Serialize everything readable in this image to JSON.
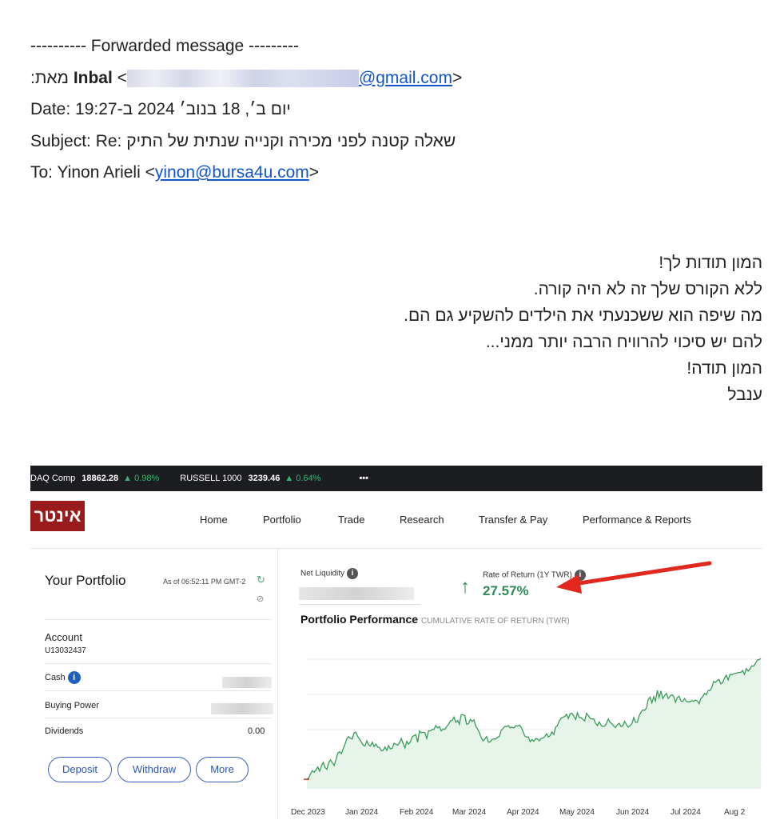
{
  "email": {
    "separator": "---------- Forwarded message ---------",
    "from_label": ":מאת",
    "from_name": "Inbal",
    "from_email_domain": "@gmail.com",
    "from_close": ">",
    "from_open": "<",
    "date_line": "Date: יום ב׳, 18 בנוב׳ 2024 ב-19:27",
    "subject_line": "Subject: Re: שאלה קטנה לפני מכירה וקנייה שנתית של התיק",
    "to_prefix": "To: Yinon Arieli <",
    "to_email": "yinon@bursa4u.com",
    "to_suffix": ">"
  },
  "message_lines": [
    "המון תודות לך!",
    "ללא הקורס שלך זה לא היה קורה.",
    "מה שיפה הוא ששכנעתי את הילדים להשקיע גם הם.",
    "להם יש סיכוי להרוויח הרבה יותר ממני...",
    "המון תודה!",
    "ענבל"
  ],
  "ticker": {
    "item1_name": "DAQ Comp",
    "item1_value": "18862.28",
    "item1_change": "▲ 0.98%",
    "item2_name": "RUSSELL 1000",
    "item2_value": "3239.46",
    "item2_change": "▲ 0.64%",
    "more": "•••"
  },
  "brand": "אינטר",
  "nav": [
    "Home",
    "Portfolio",
    "Trade",
    "Research",
    "Transfer & Pay",
    "Performance & Reports"
  ],
  "portfolio": {
    "title": "Your Portfolio",
    "as_of": "As of 06:52:11 PM GMT-2",
    "account_label": "Account",
    "account_id": "U13032437",
    "cash_label": "Cash",
    "buying_power_label": "Buying Power",
    "dividends_label": "Dividends",
    "dividends_value": "0.00",
    "buttons": [
      "Deposit",
      "Withdraw",
      "More"
    ]
  },
  "summary": {
    "net_liquidity_label": "Net Liquidity",
    "ror_label": "Rate of Return (1Y TWR)",
    "ror_value": "27.57%",
    "perf_title": "Portfolio Performance",
    "perf_subtitle": "CUMULATIVE RATE OF RETURN (TWR)"
  },
  "colors": {
    "accent_green": "#2e8b57",
    "arrow_red": "#e0281e",
    "link_blue": "#1155cc"
  },
  "chart_data": {
    "type": "area",
    "title": "Portfolio Performance",
    "subtitle": "CUMULATIVE RATE OF RETURN (TWR)",
    "x_tick_labels": [
      "Dec 2023",
      "Jan 2024",
      "Feb 2024",
      "Mar 2024",
      "Apr 2024",
      "May 2024",
      "Jun 2024",
      "Jul 2024",
      "Aug 2"
    ],
    "x": [
      0,
      1,
      2,
      3,
      4,
      5,
      6,
      7,
      8,
      9,
      10,
      11,
      12,
      13,
      14,
      15,
      16,
      17,
      18,
      19,
      20,
      21,
      22,
      23,
      24,
      25,
      26,
      27,
      28,
      29,
      30,
      31,
      32,
      33,
      34,
      35,
      36,
      37,
      38,
      39,
      40,
      41,
      42,
      43,
      44,
      45,
      46,
      47,
      48,
      49,
      50,
      51,
      52,
      53,
      54,
      55,
      56,
      57,
      58,
      59,
      60,
      61,
      62,
      63,
      64,
      65,
      66,
      67,
      68,
      69,
      70,
      71,
      72,
      73,
      74,
      75,
      76,
      77,
      78,
      79,
      80,
      81,
      82,
      83,
      84,
      85,
      86,
      87,
      88,
      89,
      90,
      91,
      92,
      93,
      94,
      95,
      96,
      97,
      98,
      99,
      100,
      101,
      102,
      103,
      104,
      105,
      106,
      107,
      108,
      109,
      110,
      111,
      112,
      113,
      114,
      115,
      116,
      117,
      118,
      119,
      120,
      121,
      122,
      123,
      124,
      125,
      126,
      127,
      128,
      129,
      130,
      131,
      132,
      133,
      134,
      135,
      136,
      137,
      138,
      139,
      140,
      141,
      142,
      143,
      144,
      145,
      146,
      147,
      148,
      149,
      150,
      151,
      152,
      153,
      154,
      155,
      156,
      157,
      158,
      159,
      160,
      161,
      162,
      163,
      164,
      165,
      166,
      167,
      168,
      169,
      170,
      171,
      172,
      173,
      174,
      175,
      176,
      177,
      178,
      179,
      180,
      181,
      182,
      183,
      184,
      185,
      186,
      187,
      188,
      189,
      190,
      191,
      192,
      193,
      194,
      195,
      196,
      197,
      198,
      199,
      200,
      201,
      202,
      203,
      204,
      205,
      206,
      207,
      208,
      209,
      210,
      211,
      212,
      213,
      214,
      215,
      216,
      217,
      218,
      219,
      220,
      221,
      222,
      223,
      224,
      225,
      226,
      227,
      228,
      229,
      230,
      231,
      232,
      233,
      234,
      235,
      236,
      237,
      238,
      239,
      240,
      241,
      242,
      243,
      244,
      245,
      246,
      247,
      248,
      249,
      250
    ],
    "y": [
      0.0,
      0.3,
      1.1,
      1.8,
      1.5,
      2.0,
      2.6,
      1.7,
      2.8,
      3.6,
      2.5,
      2.1,
      3.5,
      4.1,
      3.5,
      2.9,
      4.1,
      5.5,
      5.8,
      5.4,
      6.4,
      7.4,
      8.6,
      9.0,
      8.6,
      8.5,
      9.8,
      9.9,
      9.0,
      8.5,
      7.8,
      7.2,
      7.0,
      8.1,
      7.3,
      7.0,
      7.8,
      6.9,
      7.4,
      6.8,
      6.7,
      6.0,
      6.1,
      6.8,
      6.1,
      7.1,
      6.4,
      6.5,
      7.6,
      7.4,
      7.2,
      7.7,
      8.6,
      7.6,
      6.6,
      8.0,
      7.4,
      7.9,
      8.9,
      9.2,
      9.4,
      7.8,
      10.2,
      9.8,
      9.9,
      9.8,
      8.6,
      10.2,
      10.2,
      10.5,
      10.5,
      11.3,
      10.8,
      11.1,
      10.2,
      10.6,
      10.5,
      11.1,
      11.6,
      12.3,
      12.4,
      13.1,
      12.0,
      12.4,
      11.6,
      13.6,
      13.6,
      13.4,
      11.6,
      11.7,
      12.6,
      12.2,
      12.5,
      11.2,
      10.6,
      9.8,
      8.8,
      8.1,
      8.5,
      9.0,
      7.8,
      7.9,
      8.4,
      8.5,
      8.5,
      8.9,
      9.0,
      10.3,
      10.7,
      11.1,
      11.1,
      11.3,
      10.8,
      11.0,
      10.8,
      11.3,
      11.2,
      11.4,
      11.0,
      10.1,
      9.1,
      8.9,
      8.9,
      7.9,
      8.4,
      8.0,
      8.6,
      8.5,
      8.1,
      8.6,
      8.7,
      9.0,
      9.6,
      8.9,
      9.2,
      10.0,
      9.4,
      11.0,
      11.3,
      12.3,
      12.8,
      13.1,
      13.2,
      13.7,
      12.8,
      13.8,
      13.9,
      13.3,
      12.6,
      14.0,
      13.0,
      13.0,
      12.6,
      12.3,
      13.9,
      13.4,
      12.8,
      12.7,
      12.7,
      11.8,
      11.3,
      12.1,
      11.4,
      11.1,
      11.2,
      11.8,
      12.7,
      12.0,
      11.7,
      11.2,
      10.9,
      11.5,
      11.8,
      11.1,
      11.3,
      12.2,
      11.5,
      11.0,
      11.3,
      11.7,
      13.0,
      12.0,
      12.0,
      13.4,
      14.1,
      14.6,
      14.5,
      15.0,
      16.8,
      17.3,
      16.1,
      17.4,
      16.5,
      18.7,
      17.2,
      18.6,
      17.0,
      17.6,
      18.1,
      17.0,
      17.5,
      17.8,
      17.5,
      16.2,
      17.2,
      17.5,
      16.5,
      16.4,
      17.0,
      16.4,
      16.3,
      16.3,
      16.6,
      16.4,
      16.7,
      16.5,
      15.9,
      17.0,
      17.4,
      18.1,
      17.8,
      18.7,
      18.7,
      19.3,
      20.6,
      20.4,
      20.8,
      21.0,
      20.1,
      20.4,
      21.3,
      21.9,
      20.9,
      22.1,
      22.0,
      22.2,
      22.3,
      22.4,
      22.5,
      22.5,
      22.9,
      22.1,
      23.3,
      22.8,
      23.2,
      23.9,
      23.8,
      24.4,
      25.1,
      25.2,
      25.4
    ],
    "ylim": [
      -2,
      30
    ],
    "grid": true,
    "line_color": "#3a9a5a",
    "fill_color": "#e6f4ea"
  }
}
